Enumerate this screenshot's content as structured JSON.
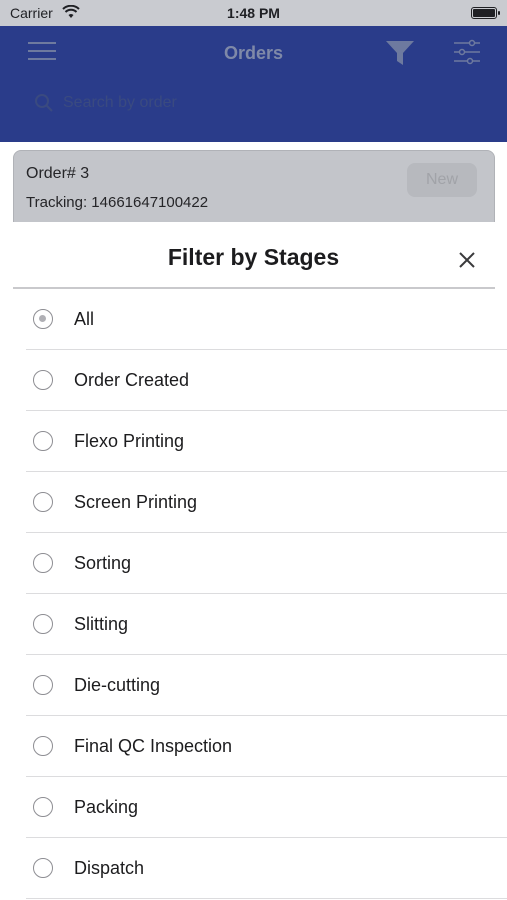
{
  "status_bar": {
    "carrier": "Carrier",
    "time": "1:48 PM"
  },
  "header": {
    "title": "Orders",
    "search_placeholder": "Search by order",
    "icons": [
      "menu-icon",
      "filter-icon",
      "sliders-icon",
      "search-icon"
    ]
  },
  "order_card": {
    "order_no": "Order# 3",
    "tracking": "Tracking: 14661647100422",
    "status": "New"
  },
  "sheet": {
    "title": "Filter by Stages",
    "selected": "All",
    "stages": [
      {
        "label": "All",
        "selected": true
      },
      {
        "label": "Order Created",
        "selected": false
      },
      {
        "label": "Flexo Printing",
        "selected": false
      },
      {
        "label": "Screen Printing",
        "selected": false
      },
      {
        "label": "Sorting",
        "selected": false
      },
      {
        "label": "Slitting",
        "selected": false
      },
      {
        "label": "Die-cutting",
        "selected": false
      },
      {
        "label": "Final QC Inspection",
        "selected": false
      },
      {
        "label": "Packing",
        "selected": false
      },
      {
        "label": "Dispatch",
        "selected": false
      }
    ]
  },
  "colors": {
    "header_bg": "#2a3c8a",
    "sheet_bg": "#ffffff",
    "divider": "#c9c9cc"
  }
}
